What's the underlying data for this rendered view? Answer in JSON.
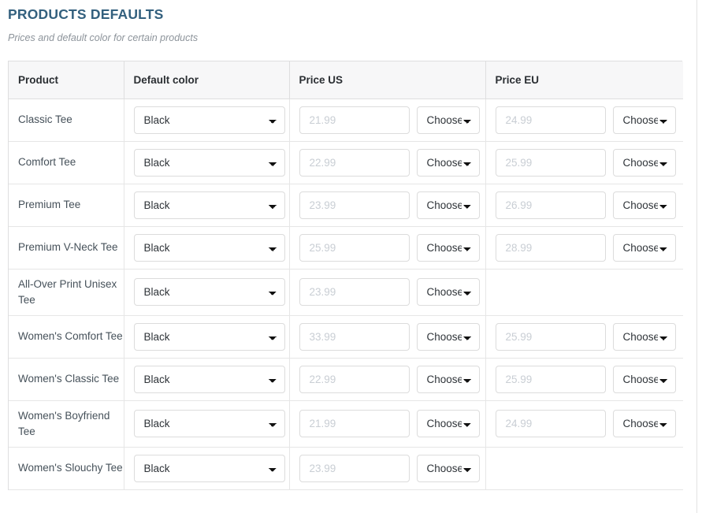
{
  "header": {
    "title": "PRODUCTS DEFAULTS",
    "subtitle": "Prices and default color for certain products"
  },
  "table": {
    "columns": [
      {
        "key": "product",
        "label": "Product"
      },
      {
        "key": "color",
        "label": "Default color"
      },
      {
        "key": "price_us",
        "label": "Price US"
      },
      {
        "key": "price_eu",
        "label": "Price EU"
      }
    ],
    "color_selected": "Black",
    "currency_selected": "Choose...",
    "rows": [
      {
        "product": "Classic Tee",
        "color": "Black",
        "price_us_placeholder": "21.99",
        "price_us_currency": "Choose...",
        "price_eu_placeholder": "24.99",
        "price_eu_currency": "Choose...",
        "price_eu_empty": false
      },
      {
        "product": "Comfort Tee",
        "color": "Black",
        "price_us_placeholder": "22.99",
        "price_us_currency": "Choose...",
        "price_eu_placeholder": "25.99",
        "price_eu_currency": "Choose...",
        "price_eu_empty": false
      },
      {
        "product": "Premium Tee",
        "color": "Black",
        "price_us_placeholder": "23.99",
        "price_us_currency": "Choose...",
        "price_eu_placeholder": "26.99",
        "price_eu_currency": "Choose...",
        "price_eu_empty": false
      },
      {
        "product": "Premium V-Neck Tee",
        "color": "Black",
        "price_us_placeholder": "25.99",
        "price_us_currency": "Choose...",
        "price_eu_placeholder": "28.99",
        "price_eu_currency": "Choose...",
        "price_eu_empty": false
      },
      {
        "product": "All-Over Print Unisex Tee",
        "color": "Black",
        "price_us_placeholder": "23.99",
        "price_us_currency": "Choose...",
        "price_eu_placeholder": "",
        "price_eu_currency": "",
        "price_eu_empty": true
      },
      {
        "product": "Women's Comfort Tee",
        "color": "Black",
        "price_us_placeholder": "33.99",
        "price_us_currency": "Choose...",
        "price_eu_placeholder": "25.99",
        "price_eu_currency": "Choose...",
        "price_eu_empty": false
      },
      {
        "product": "Women's Classic Tee",
        "color": "Black",
        "price_us_placeholder": "22.99",
        "price_us_currency": "Choose...",
        "price_eu_placeholder": "25.99",
        "price_eu_currency": "Choose...",
        "price_eu_empty": false
      },
      {
        "product": "Women's Boyfriend Tee",
        "color": "Black",
        "price_us_placeholder": "21.99",
        "price_us_currency": "Choose...",
        "price_eu_placeholder": "24.99",
        "price_eu_currency": "Choose...",
        "price_eu_empty": false
      },
      {
        "product": "Women's Slouchy Tee",
        "color": "Black",
        "price_us_placeholder": "23.99",
        "price_us_currency": "Choose...",
        "price_eu_placeholder": "",
        "price_eu_currency": "",
        "price_eu_empty": true
      }
    ]
  },
  "colors": {
    "title": "#33607e",
    "subtitle": "#8d949b",
    "header_bg": "#f7f7f8",
    "border": "#dededf",
    "row_border": "#e6e6e6",
    "placeholder": "#c9ced4"
  }
}
